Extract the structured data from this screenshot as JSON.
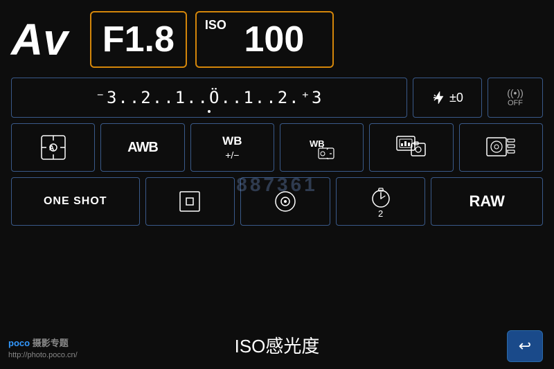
{
  "header": {
    "mode": "Av",
    "aperture": "F1.8",
    "iso_label": "ISO",
    "iso_value": "100"
  },
  "exposure": {
    "scale": "⁻3..2..1..0..1..2.⁺3",
    "flash_comp_icon": "⚡±",
    "flash_comp_value": "±0",
    "wifi_label": "((•))\nOFF"
  },
  "row3": [
    {
      "id": "metering",
      "label": "☀A"
    },
    {
      "id": "awb",
      "label": "AWB"
    },
    {
      "id": "wb_adjust",
      "label": "WB\n+/−"
    },
    {
      "id": "wb_shift",
      "label": "WB"
    },
    {
      "id": "picture_style",
      "label": ""
    },
    {
      "id": "lens_correction",
      "label": ""
    }
  ],
  "row4": [
    {
      "id": "one_shot",
      "label": "ONE SHOT"
    },
    {
      "id": "af_mode",
      "label": "□"
    },
    {
      "id": "live_view",
      "label": "⊙"
    },
    {
      "id": "self_timer",
      "label": "⏱2"
    },
    {
      "id": "image_quality",
      "label": "RAW"
    }
  ],
  "bottom": {
    "label": "ISO感光度",
    "back_arrow": "↩"
  },
  "watermark": {
    "text": "887361",
    "poco_brand": "poco 摄影专题",
    "poco_url": "http://photo.poco.cn/"
  }
}
